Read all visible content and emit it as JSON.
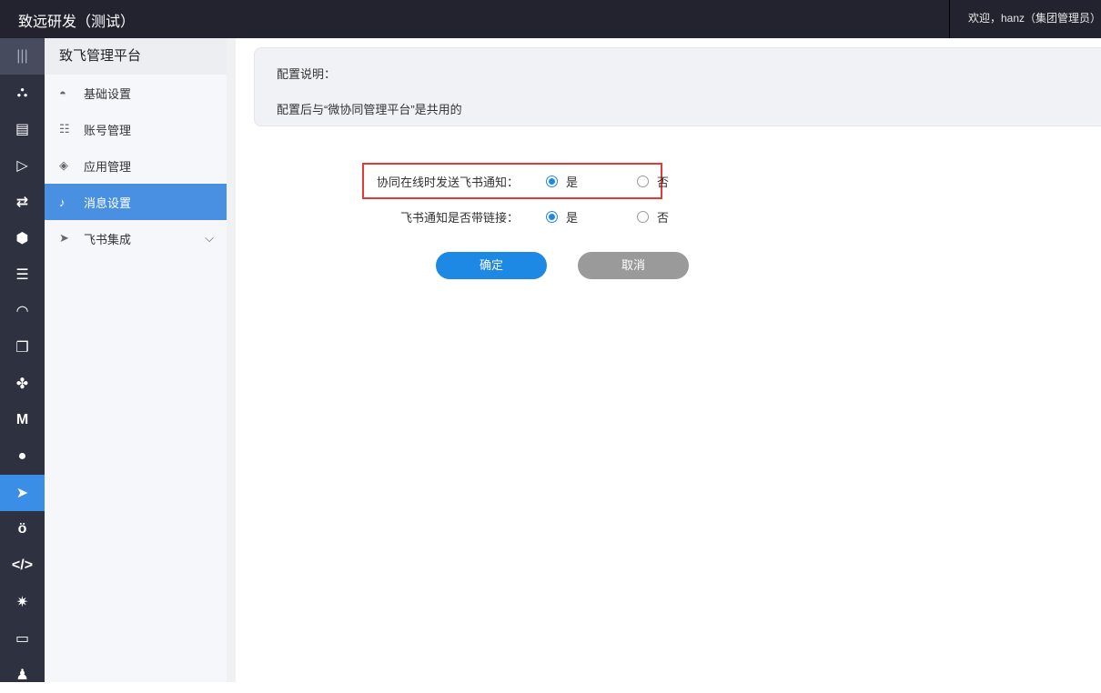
{
  "header": {
    "title": "致远研发（测试）",
    "welcome": "欢迎，hanz（集团管理员）"
  },
  "rail": [
    "menu-icon",
    "org-icon",
    "panel-icon",
    "send-outline-icon",
    "flow-icon",
    "cap-icon",
    "db-icon",
    "gauge-icon",
    "file-icon",
    "apps-icon",
    "m-icon",
    "wechat-icon",
    "feishu-icon",
    "robot-icon",
    "code-icon",
    "gear-icon",
    "laptop-icon",
    "user-icon"
  ],
  "sidebar": {
    "title": "致飞管理平台",
    "items": [
      {
        "label": "基础设置",
        "icon": "dashboard-icon"
      },
      {
        "label": "账号管理",
        "icon": "account-icon"
      },
      {
        "label": "应用管理",
        "icon": "app-icon"
      },
      {
        "label": "消息设置",
        "icon": "bell-icon"
      },
      {
        "label": "飞书集成",
        "icon": "send-icon"
      }
    ]
  },
  "info": {
    "title": "配置说明：",
    "text": "配置后与“微协同管理平台”是共用的"
  },
  "form": {
    "rows": [
      {
        "label": "协同在线时发送飞书通知：",
        "yes": "是",
        "no": "否",
        "value": "是"
      },
      {
        "label": "飞书通知是否带链接：",
        "yes": "是",
        "no": "否",
        "value": "是"
      }
    ],
    "confirm": "确定",
    "cancel": "取消"
  },
  "colors": {
    "accent": "#1e88e5",
    "active": "#4a90e2",
    "highlight": "#e53935"
  }
}
